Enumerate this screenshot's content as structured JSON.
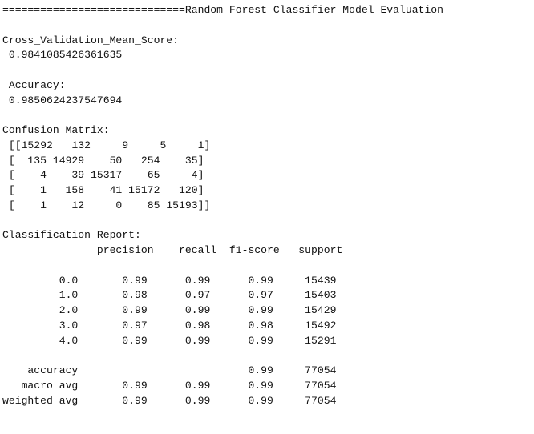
{
  "output_lines": [
    "=============================Random Forest Classifier Model Evaluation",
    "",
    "Cross_Validation_Mean_Score:",
    " 0.9841085426361635",
    "",
    " Accuracy:",
    " 0.9850624237547694",
    "",
    "Confusion Matrix:",
    " [[15292   132     9     5     1]",
    " [  135 14929    50   254    35]",
    " [    4    39 15317    65     4]",
    " [    1   158    41 15172   120]",
    " [    1    12     0    85 15193]]",
    "",
    "Classification_Report:",
    "               precision    recall  f1-score   support",
    "",
    "         0.0       0.99      0.99      0.99     15439",
    "         1.0       0.98      0.97      0.97     15403",
    "         2.0       0.99      0.99      0.99     15429",
    "         3.0       0.97      0.98      0.98     15492",
    "         4.0       0.99      0.99      0.99     15291",
    "",
    "    accuracy                           0.99     77054",
    "   macro avg       0.99      0.99      0.99     77054",
    "weighted avg       0.99      0.99      0.99     77054"
  ]
}
